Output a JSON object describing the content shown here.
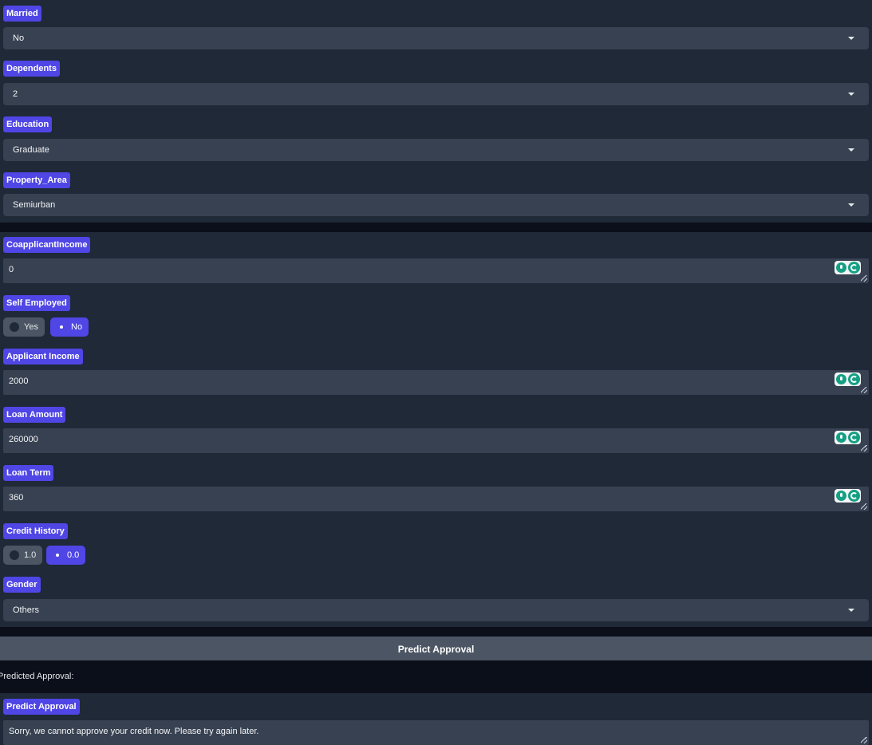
{
  "married": {
    "label": "Married",
    "value": "No"
  },
  "dependents": {
    "label": "Dependents",
    "value": "2"
  },
  "education": {
    "label": "Education",
    "value": "Graduate"
  },
  "property_area": {
    "label": "Property_Area",
    "value": "Semiurban"
  },
  "coapplicant_income": {
    "label": "CoapplicantIncome",
    "value": "0"
  },
  "self_employed": {
    "label": "Self Employed",
    "options": [
      "Yes",
      "No"
    ],
    "selected": "No"
  },
  "applicant_income": {
    "label": "Applicant Income",
    "value": "2000"
  },
  "loan_amount": {
    "label": "Loan Amount",
    "value": "260000"
  },
  "loan_term": {
    "label": "Loan Term",
    "value": "360"
  },
  "credit_history": {
    "label": "Credit History",
    "options": [
      "1.0",
      "0.0"
    ],
    "selected": "0.0"
  },
  "gender": {
    "label": "Gender",
    "value": "Others"
  },
  "predict_button": {
    "label": "Predict Approval"
  },
  "result_caption": "Predicted Approval:",
  "output": {
    "label": "Predict Approval",
    "value": "Sorry, we cannot approve your credit now. Please try again later."
  },
  "colors": {
    "accent": "#4f46e5",
    "panel": "#1f2937",
    "input": "#374151",
    "page": "#0b0f19",
    "grammarly": "#15a085"
  }
}
